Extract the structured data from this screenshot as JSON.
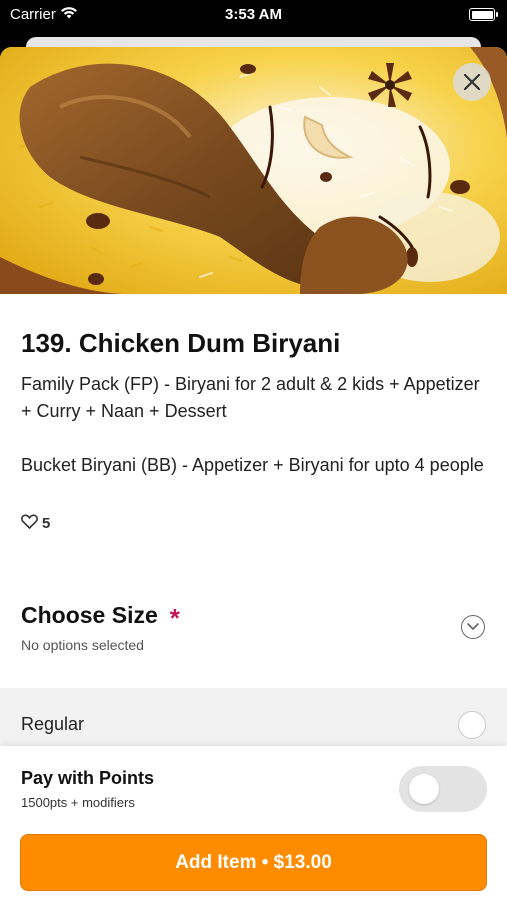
{
  "status_bar": {
    "carrier": "Carrier",
    "time": "3:53 AM",
    "icons": [
      "wifi-icon",
      "battery-icon"
    ]
  },
  "item": {
    "title": "139. Chicken Dum Biryani",
    "description": [
      "Family Pack (FP) - Biryani for 2 adult & 2 kids + Appetizer + Curry + Naan + Dessert",
      "Bucket Biryani (BB) - Appetizer + Biryani for upto 4 people"
    ],
    "likes": "5",
    "image_icon": "chicken-biryani-photo"
  },
  "choose_size": {
    "title": "Choose Size",
    "required_marker": "*",
    "subtitle": "No options selected",
    "options": [
      {
        "label": "Regular",
        "selected": false
      }
    ]
  },
  "points": {
    "title": "Pay with Points",
    "subtitle": "1500pts + modifiers",
    "enabled": false
  },
  "add_button": {
    "label": "Add Item • $13.00"
  },
  "colors": {
    "accent": "#ff8c00",
    "required": "#c2185b",
    "toggle_off": "#e3e3e3"
  }
}
